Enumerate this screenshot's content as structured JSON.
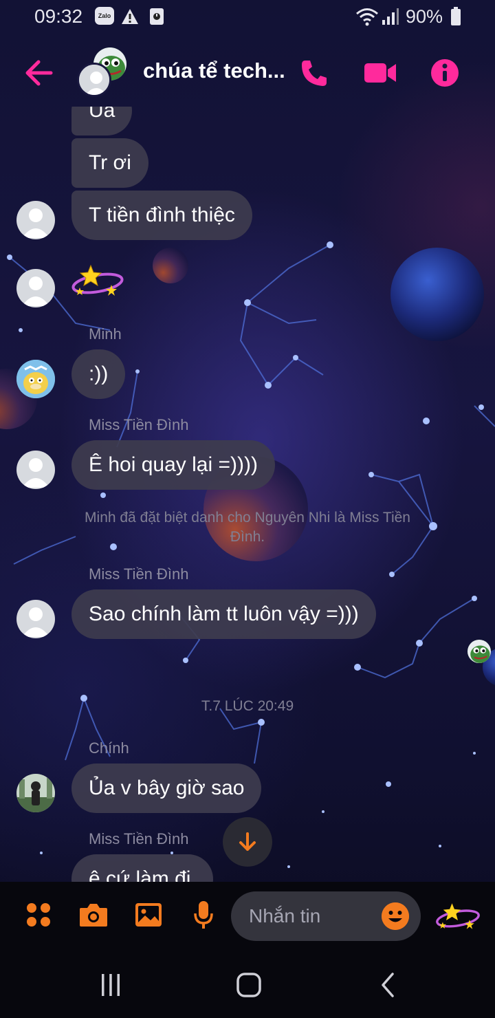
{
  "status_bar": {
    "time": "09:32",
    "app_badge": "Zalo",
    "battery": "90%"
  },
  "header": {
    "title": "chúa tể tech...",
    "accent_color": "#ff2a9c"
  },
  "messages": [
    {
      "type": "bubble",
      "text": "Ủa"
    },
    {
      "type": "bubble",
      "text": "Tr ơi"
    },
    {
      "type": "bubble",
      "text": "T tiền đình thiệc"
    },
    {
      "type": "sticker",
      "icon": "stars-sticker"
    },
    {
      "type": "sender",
      "text": "Minh"
    },
    {
      "type": "bubble",
      "text": ":))"
    },
    {
      "type": "sender",
      "text": "Miss Tiền Đình"
    },
    {
      "type": "bubble",
      "text": "Ê hoi quay lại =))))"
    },
    {
      "type": "system",
      "text": "Minh đã đặt biệt danh cho Nguyên Nhi là Miss Tiền Đình."
    },
    {
      "type": "sender",
      "text": "Miss Tiền Đình"
    },
    {
      "type": "bubble",
      "text": "Sao chính làm tt luôn vậy =)))"
    },
    {
      "type": "timestamp",
      "text": "T.7 LÚC 20:49"
    },
    {
      "type": "sender",
      "text": "Chính"
    },
    {
      "type": "bubble",
      "text": "Ủa v bây giờ sao"
    },
    {
      "type": "sender",
      "text": "Miss Tiền Đình"
    },
    {
      "type": "bubble",
      "text": "ê cứ làm đi"
    }
  ],
  "composer": {
    "placeholder": "Nhắn tin",
    "accent_color": "#f37b1f"
  }
}
